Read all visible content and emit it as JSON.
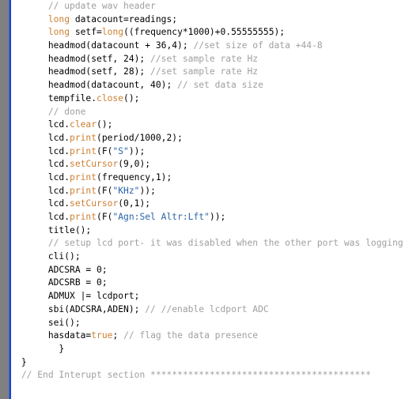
{
  "editor": {
    "name": "arduino-code-editor",
    "background": "#ffffff",
    "gutter_color": "#808080",
    "fold_marker_color": "#1b44c8",
    "colors": {
      "keyword": "#cc8033",
      "function": "#cc8033",
      "string": "#2b64a8",
      "comment": "#a0a0a0",
      "plain": "#000000"
    },
    "lines": [
      {
        "indent": 6,
        "tokens": [
          {
            "t": "cmt",
            "s": "// update wav header"
          }
        ]
      },
      {
        "indent": 6,
        "tokens": [
          {
            "t": "kw",
            "s": "long"
          },
          {
            "t": "pln",
            "s": " datacount=readings;"
          }
        ]
      },
      {
        "indent": 6,
        "tokens": [
          {
            "t": "kw",
            "s": "long"
          },
          {
            "t": "pln",
            "s": " setf="
          },
          {
            "t": "kw",
            "s": "long"
          },
          {
            "t": "pln",
            "s": "((frequency*1000)+0.55555555);"
          }
        ]
      },
      {
        "indent": 6,
        "tokens": [
          {
            "t": "pln",
            "s": "headmod(datacount + 36,4); "
          },
          {
            "t": "cmt",
            "s": "//set size of data +44-8"
          }
        ]
      },
      {
        "indent": 6,
        "tokens": [
          {
            "t": "pln",
            "s": "headmod(setf, 24); "
          },
          {
            "t": "cmt",
            "s": "//set sample rate Hz"
          }
        ]
      },
      {
        "indent": 6,
        "tokens": [
          {
            "t": "pln",
            "s": "headmod(setf, 28); "
          },
          {
            "t": "cmt",
            "s": "//set sample rate Hz"
          }
        ]
      },
      {
        "indent": 6,
        "tokens": [
          {
            "t": "pln",
            "s": "headmod(datacount, 40); "
          },
          {
            "t": "cmt",
            "s": "// set data size"
          }
        ]
      },
      {
        "indent": 6,
        "tokens": [
          {
            "t": "pln",
            "s": "tempfile."
          },
          {
            "t": "fn",
            "s": "close"
          },
          {
            "t": "pln",
            "s": "();"
          }
        ]
      },
      {
        "indent": 6,
        "tokens": [
          {
            "t": "cmt",
            "s": "// done"
          }
        ]
      },
      {
        "indent": 6,
        "tokens": [
          {
            "t": "pln",
            "s": "lcd."
          },
          {
            "t": "fn",
            "s": "clear"
          },
          {
            "t": "pln",
            "s": "();"
          }
        ]
      },
      {
        "indent": 6,
        "tokens": [
          {
            "t": "pln",
            "s": "lcd."
          },
          {
            "t": "fn",
            "s": "print"
          },
          {
            "t": "pln",
            "s": "(period/1000,2);"
          }
        ]
      },
      {
        "indent": 6,
        "tokens": [
          {
            "t": "pln",
            "s": "lcd."
          },
          {
            "t": "fn",
            "s": "print"
          },
          {
            "t": "pln",
            "s": "(F("
          },
          {
            "t": "str",
            "s": "\"S\""
          },
          {
            "t": "pln",
            "s": "));"
          }
        ]
      },
      {
        "indent": 6,
        "tokens": [
          {
            "t": "pln",
            "s": "lcd."
          },
          {
            "t": "fn",
            "s": "setCursor"
          },
          {
            "t": "pln",
            "s": "(9,0);"
          }
        ]
      },
      {
        "indent": 6,
        "tokens": [
          {
            "t": "pln",
            "s": "lcd."
          },
          {
            "t": "fn",
            "s": "print"
          },
          {
            "t": "pln",
            "s": "(frequency,1);"
          }
        ]
      },
      {
        "indent": 6,
        "tokens": [
          {
            "t": "pln",
            "s": "lcd."
          },
          {
            "t": "fn",
            "s": "print"
          },
          {
            "t": "pln",
            "s": "(F("
          },
          {
            "t": "str",
            "s": "\"KHz\""
          },
          {
            "t": "pln",
            "s": "));"
          }
        ]
      },
      {
        "indent": 6,
        "tokens": [
          {
            "t": "pln",
            "s": "lcd."
          },
          {
            "t": "fn",
            "s": "setCursor"
          },
          {
            "t": "pln",
            "s": "(0,1);"
          }
        ]
      },
      {
        "indent": 6,
        "tokens": [
          {
            "t": "pln",
            "s": "lcd."
          },
          {
            "t": "fn",
            "s": "print"
          },
          {
            "t": "pln",
            "s": "(F("
          },
          {
            "t": "str",
            "s": "\"Agn:Sel Altr:Lft\""
          },
          {
            "t": "pln",
            "s": "));"
          }
        ]
      },
      {
        "indent": 6,
        "tokens": [
          {
            "t": "pln",
            "s": "title();"
          }
        ]
      },
      {
        "indent": 6,
        "tokens": [
          {
            "t": "cmt",
            "s": "// setup lcd port- it was disabled when the other port was logging"
          }
        ]
      },
      {
        "indent": 6,
        "tokens": [
          {
            "t": "pln",
            "s": "cli();"
          }
        ]
      },
      {
        "indent": 6,
        "tokens": [
          {
            "t": "pln",
            "s": "ADCSRA = 0;"
          }
        ]
      },
      {
        "indent": 6,
        "tokens": [
          {
            "t": "pln",
            "s": "ADCSRB = 0;"
          }
        ]
      },
      {
        "indent": 6,
        "tokens": [
          {
            "t": "pln",
            "s": "ADMUX |= lcdport;"
          }
        ]
      },
      {
        "indent": 6,
        "tokens": [
          {
            "t": "pln",
            "s": "sbi(ADCSRA,ADEN); "
          },
          {
            "t": "cmt",
            "s": "// //enable lcdport ADC"
          }
        ]
      },
      {
        "indent": 6,
        "tokens": [
          {
            "t": "pln",
            "s": "sei();"
          }
        ]
      },
      {
        "indent": 6,
        "tokens": [
          {
            "t": "pln",
            "s": "hasdata="
          },
          {
            "t": "kw",
            "s": "true"
          },
          {
            "t": "pln",
            "s": "; "
          },
          {
            "t": "cmt",
            "s": "// flag the data presence"
          }
        ]
      },
      {
        "indent": 6,
        "tokens": [
          {
            "t": "pln",
            "s": "  }"
          }
        ]
      },
      {
        "indent": 1,
        "tokens": [
          {
            "t": "pln",
            "s": "}"
          }
        ]
      },
      {
        "indent": 1,
        "tokens": [
          {
            "t": "cmt",
            "s": "// End Interupt section *****************************************"
          }
        ]
      }
    ]
  }
}
